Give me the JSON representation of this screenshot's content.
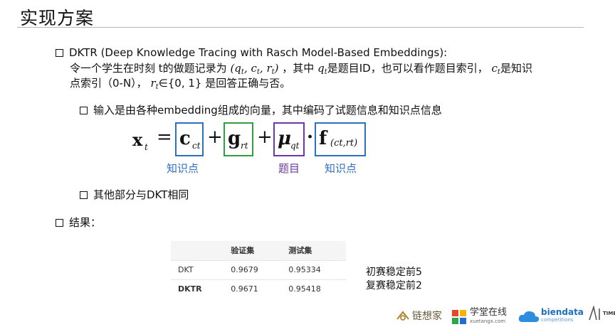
{
  "slide": {
    "title": "实现方案"
  },
  "bullets": {
    "b1_heading": "DKTR (Deep Knowledge Tracing with Rasch Model-Based Embeddings):",
    "b1_line1_pre": "令一个学生在时刻 t的做题记录为",
    "b1_tuple": "(q",
    "b1_tuple_full": "(qt, ct, rt)",
    "b1_line1_mid": "，其中",
    "b1_q_def": "是题目ID，也可以看作题目索引，",
    "b1_c_def": "是知识",
    "b1_line2_pre": "点索引（0-N），",
    "b1_r_set": "∈{0, 1}",
    "b1_line2_post": "是回答正确与否。",
    "b2": "输入是由各种embedding组成的向量，其中编码了试题信息和知识点信息",
    "b3": "其他部分与DKT相同",
    "b4": "结果："
  },
  "formula": {
    "lhs": "x",
    "lhs_sub": "t",
    "eq": "=",
    "term1": "c",
    "term1_sub": "ct",
    "plus1": "+",
    "term2": "g",
    "term2_sub": "rt",
    "plus2": "+",
    "term3": "μ",
    "term3_sub": "qt",
    "dot": "·",
    "term4": "f",
    "term4_sub": "(ct,rt)",
    "label1": "知识点",
    "label3": "题目",
    "label4": "知识点",
    "colors": {
      "blue": "#2f6fbf",
      "green": "#2e9e3e",
      "purple": "#6a3aa0"
    }
  },
  "results": {
    "columns": [
      "",
      "验证集",
      "测试集"
    ],
    "rows": [
      {
        "model": "DKT",
        "valid": "0.9679",
        "test": "0.95334"
      },
      {
        "model": "DKTR",
        "valid": "0.9671",
        "test": "0.95418"
      }
    ]
  },
  "notes": {
    "prelim": "初赛稳定前5",
    "final": "复赛稳定前2"
  },
  "logos": {
    "lianxiangjia": "链想家",
    "xuetangx": "学堂在线",
    "xuetangx_url": "xuetangx.com",
    "biendata": "biendata",
    "biendata_sub": "competitions",
    "aitime": "TIME"
  }
}
